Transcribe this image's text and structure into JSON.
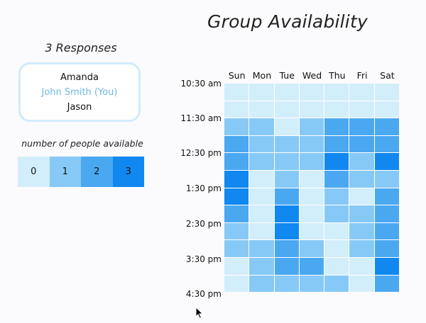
{
  "title": "Group Availability",
  "responses_title": "3 Responses",
  "respondents": [
    {
      "name": "Amanda",
      "is_you": false
    },
    {
      "name": "John Smith (You)",
      "is_you": true
    },
    {
      "name": "Jason",
      "is_you": false
    }
  ],
  "legend": {
    "label": "number of people available",
    "levels": [
      {
        "value": "0",
        "color": "#d3eefb"
      },
      {
        "value": "1",
        "color": "#87c9f6"
      },
      {
        "value": "2",
        "color": "#4aa8f1"
      },
      {
        "value": "3",
        "color": "#1088f0"
      }
    ]
  },
  "days": [
    "Sun",
    "Mon",
    "Tue",
    "Wed",
    "Thu",
    "Fri",
    "Sat"
  ],
  "times": [
    "10:30 am",
    "11:30 am",
    "12:30 pm",
    "1:30 pm",
    "2:30 pm",
    "3:30 pm",
    "4:30 pm"
  ],
  "availability": [
    [
      0,
      0,
      0,
      0,
      0,
      0,
      0
    ],
    [
      0,
      0,
      0,
      0,
      0,
      0,
      0
    ],
    [
      1,
      1,
      0,
      1,
      2,
      2,
      2
    ],
    [
      2,
      1,
      1,
      1,
      2,
      2,
      2
    ],
    [
      2,
      1,
      1,
      1,
      3,
      1,
      3
    ],
    [
      3,
      0,
      1,
      0,
      2,
      1,
      1
    ],
    [
      3,
      0,
      2,
      0,
      1,
      0,
      2
    ],
    [
      2,
      0,
      3,
      0,
      1,
      1,
      2
    ],
    [
      1,
      0,
      3,
      0,
      0,
      1,
      2
    ],
    [
      1,
      1,
      2,
      1,
      0,
      1,
      2
    ],
    [
      0,
      1,
      2,
      2,
      0,
      0,
      3
    ],
    [
      0,
      1,
      1,
      1,
      1,
      0,
      2
    ]
  ]
}
